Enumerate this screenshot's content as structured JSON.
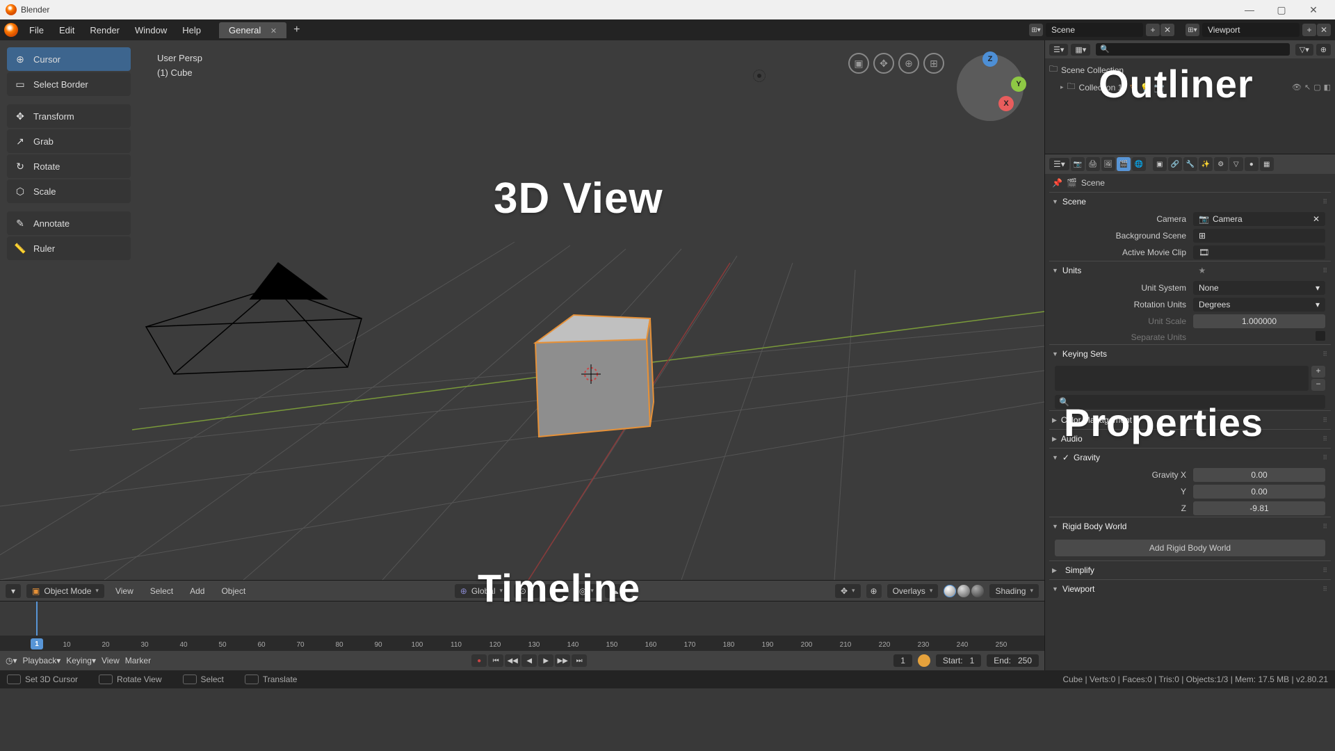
{
  "title": "Blender",
  "top_menu": [
    "File",
    "Edit",
    "Render",
    "Window",
    "Help"
  ],
  "workspace": {
    "active": "General"
  },
  "scene_selector": {
    "label": "Scene"
  },
  "layer_selector": {
    "label": "Viewport"
  },
  "viewport": {
    "info_line1": "User Persp",
    "info_line2": "(1) Cube",
    "tools": [
      {
        "label": "Cursor",
        "icon": "⊕"
      },
      {
        "label": "Select Border",
        "icon": "▢"
      },
      {
        "label": "Transform",
        "icon": "✥"
      },
      {
        "label": "Grab",
        "icon": "↗"
      },
      {
        "label": "Rotate",
        "icon": "↺"
      },
      {
        "label": "Scale",
        "icon": "⬡"
      },
      {
        "label": "Annotate",
        "icon": "✎"
      },
      {
        "label": "Ruler",
        "icon": "📏"
      }
    ],
    "axes": {
      "x": "X",
      "y": "Y",
      "z": "Z"
    },
    "header": {
      "mode": "Object Mode",
      "menus": [
        "View",
        "Select",
        "Add",
        "Object"
      ],
      "orientation": "Global",
      "overlays": "Overlays",
      "shading": "Shading"
    }
  },
  "timeline": {
    "menus": [
      "Playback",
      "Keying",
      "View",
      "Marker"
    ],
    "current": "1",
    "current_field": "1",
    "start_label": "Start:",
    "start": "1",
    "end_label": "End:",
    "end": "250",
    "ticks": [
      10,
      20,
      30,
      40,
      50,
      60,
      70,
      80,
      90,
      100,
      110,
      120,
      130,
      140,
      150,
      160,
      170,
      180,
      190,
      200,
      210,
      220,
      230,
      240,
      250
    ]
  },
  "outliner": {
    "scene_collection": "Scene Collection",
    "collection1": "Collection 1"
  },
  "properties": {
    "breadcrumb": "Scene",
    "scene": {
      "title": "Scene",
      "camera_label": "Camera",
      "camera_value": "Camera",
      "bg_label": "Background Scene",
      "clip_label": "Active Movie Clip"
    },
    "units": {
      "title": "Units",
      "system_label": "Unit System",
      "system_value": "None",
      "rotation_label": "Rotation Units",
      "rotation_value": "Degrees",
      "scale_label": "Unit Scale",
      "scale_value": "1.000000",
      "separate_label": "Separate Units"
    },
    "keying": {
      "title": "Keying Sets"
    },
    "color_mgmt": {
      "title": "Color Management"
    },
    "audio": {
      "title": "Audio"
    },
    "gravity": {
      "title": "Gravity",
      "x_label": "Gravity X",
      "x": "0.00",
      "y_label": "Y",
      "y": "0.00",
      "z_label": "Z",
      "z": "-9.81"
    },
    "rigid": {
      "title": "Rigid Body World",
      "add": "Add Rigid Body World"
    },
    "simplify": {
      "title": "Simplify"
    },
    "viewport": {
      "title": "Viewport"
    }
  },
  "status": {
    "left1": "Set 3D Cursor",
    "left2": "Rotate View",
    "left3": "Select",
    "left4": "Translate",
    "right": "Cube | Verts:0 | Faces:0 | Tris:0 | Objects:1/3 | Mem: 17.5 MB | v2.80.21"
  },
  "big_labels": {
    "view3d": "3D View",
    "outliner": "Outliner",
    "properties": "Properties",
    "timeline": "Timeline"
  }
}
